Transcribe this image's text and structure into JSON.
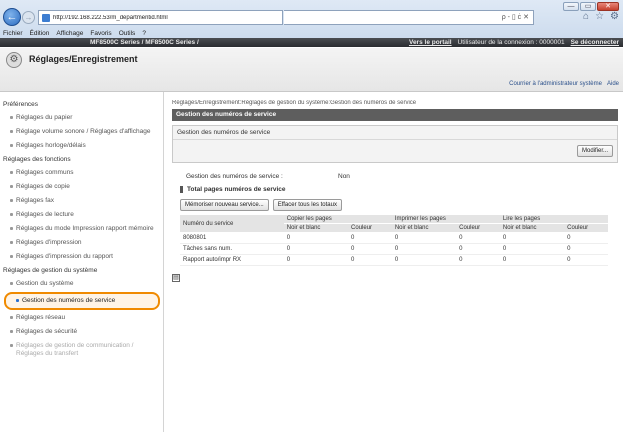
{
  "browser": {
    "url": "http://192.168.222.53/m_departmentid.html",
    "address_tools": "ρ - ▯ ċ ✕",
    "window_controls": {
      "minimize": "—",
      "maximize": "▭",
      "close": "✕"
    },
    "toolbar_icons": [
      "home-icon",
      "star-icon",
      "gear-icon"
    ],
    "menu": [
      "Fichier",
      "Édition",
      "Affichage",
      "Favoris",
      "Outils",
      "?"
    ],
    "tab_left": "MF8500C Series / MF8500C Series /",
    "portal_link": "Vers le portail",
    "user_info": "Utilisateur de la connexion : 0000001",
    "logout_link": "Se déconnecter"
  },
  "header": {
    "title": "Réglages/Enregistrement",
    "mail_admin": "Courrier à l'administrateur système",
    "help": "Aide"
  },
  "sidebar": {
    "sections": [
      {
        "label": "Préférences",
        "items": [
          {
            "label": "Réglages du papier"
          },
          {
            "label": "Réglage volume sonore / Réglages d'affichage"
          },
          {
            "label": "Réglages horloge/délais"
          }
        ]
      },
      {
        "label": "Réglages des fonctions",
        "items": [
          {
            "label": "Réglages communs"
          },
          {
            "label": "Réglages de copie"
          },
          {
            "label": "Réglages fax"
          },
          {
            "label": "Réglages de lecture"
          },
          {
            "label": "Réglages du mode Impression rapport mémoire"
          },
          {
            "label": "Réglages d'impression"
          },
          {
            "label": "Réglages d'impression du rapport"
          }
        ]
      },
      {
        "label": "Réglages de gestion du système",
        "items": [
          {
            "label": "Gestion du système"
          },
          {
            "label": "Gestion des numéros de service"
          },
          {
            "label": "Réglages réseau"
          },
          {
            "label": "Réglages de sécurité"
          },
          {
            "label": "Réglages de gestion de communication / Réglages du transfert"
          }
        ]
      }
    ]
  },
  "main": {
    "breadcrumb": "Réglages/Enregistrement:Réglages de gestion du système:Gestion des numéros de service",
    "title": "Gestion des numéros de service",
    "panel_title": "Gestion des numéros de service",
    "modify_button": "Modifier...",
    "status_label": "Gestion des numéros de service :",
    "status_value": "Non",
    "section_title": "Total pages numéros de service",
    "memorize_button": "Mémoriser nouveau service...",
    "clear_button": "Effacer tous les totaux",
    "table": {
      "col_service": "Numéro du service",
      "group_headers": [
        "Copier les pages",
        "Imprimer les pages",
        "Lire les pages"
      ],
      "sub_headers": [
        "Noir et blanc",
        "Couleur",
        "Noir et blanc",
        "Couleur",
        "Noir et blanc",
        "Couleur"
      ],
      "rows": [
        {
          "name": "8080801",
          "values": [
            "0",
            "0",
            "0",
            "0",
            "0",
            "0"
          ]
        },
        {
          "name": "Tâches sans num.",
          "values": [
            "0",
            "0",
            "0",
            "0",
            "0",
            "0"
          ]
        },
        {
          "name": "Rapport auto/impr RX",
          "values": [
            "0",
            "0",
            "0",
            "0",
            "0",
            "0"
          ]
        }
      ]
    }
  }
}
